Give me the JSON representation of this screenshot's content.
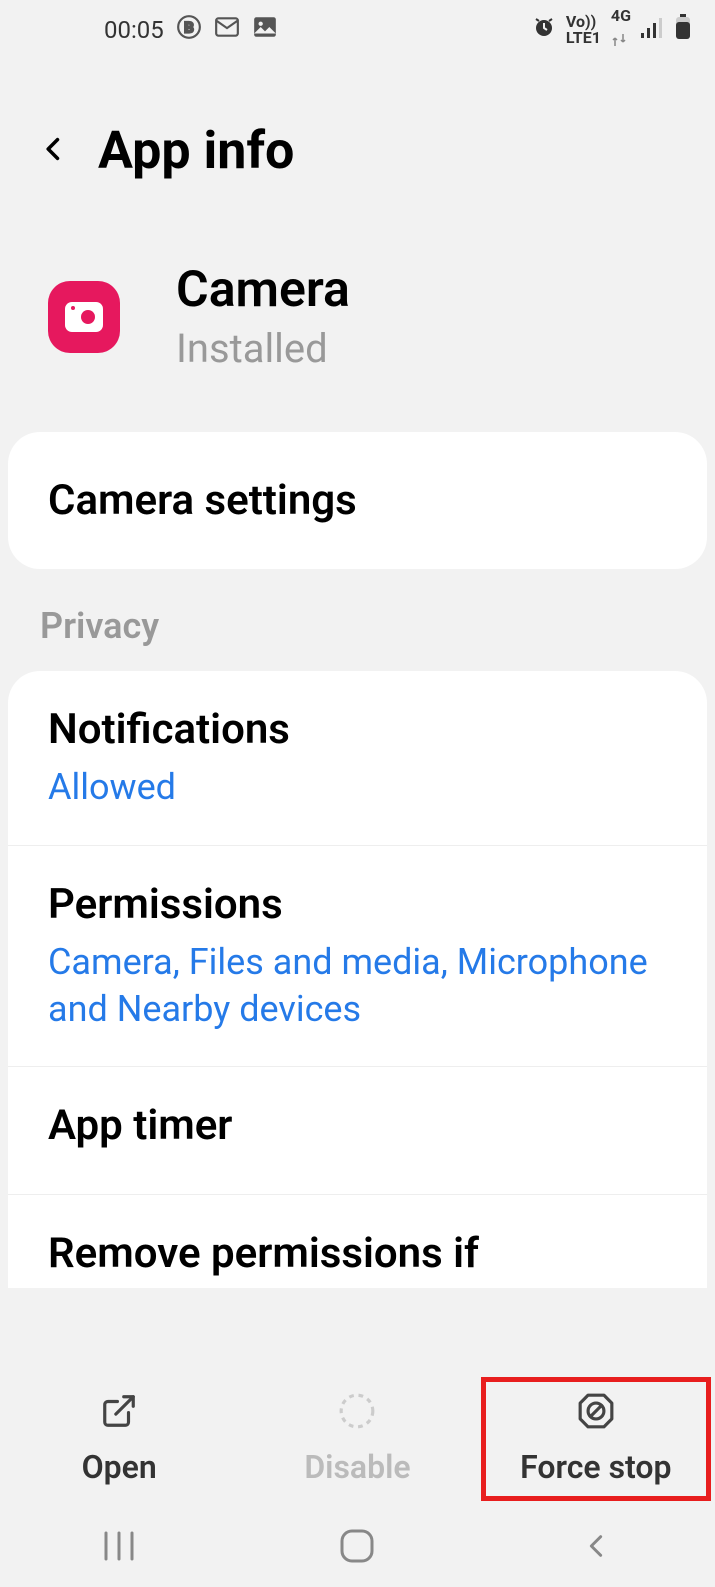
{
  "status_bar": {
    "time": "00:05",
    "volte": "Vo))",
    "lte": "LTE1",
    "network": "4G"
  },
  "header": {
    "title": "App info"
  },
  "app": {
    "name": "Camera",
    "status": "Installed"
  },
  "cards": {
    "settings_label": "Camera settings"
  },
  "sections": {
    "privacy_header": "Privacy"
  },
  "privacy_items": [
    {
      "title": "Notifications",
      "subtitle": "Allowed"
    },
    {
      "title": "Permissions",
      "subtitle": "Camera, Files and media, Microphone and Nearby devices"
    },
    {
      "title": "App timer",
      "subtitle": ""
    },
    {
      "title": "Remove permissions if",
      "subtitle": ""
    }
  ],
  "actions": {
    "open": "Open",
    "disable": "Disable",
    "force_stop": "Force stop"
  }
}
